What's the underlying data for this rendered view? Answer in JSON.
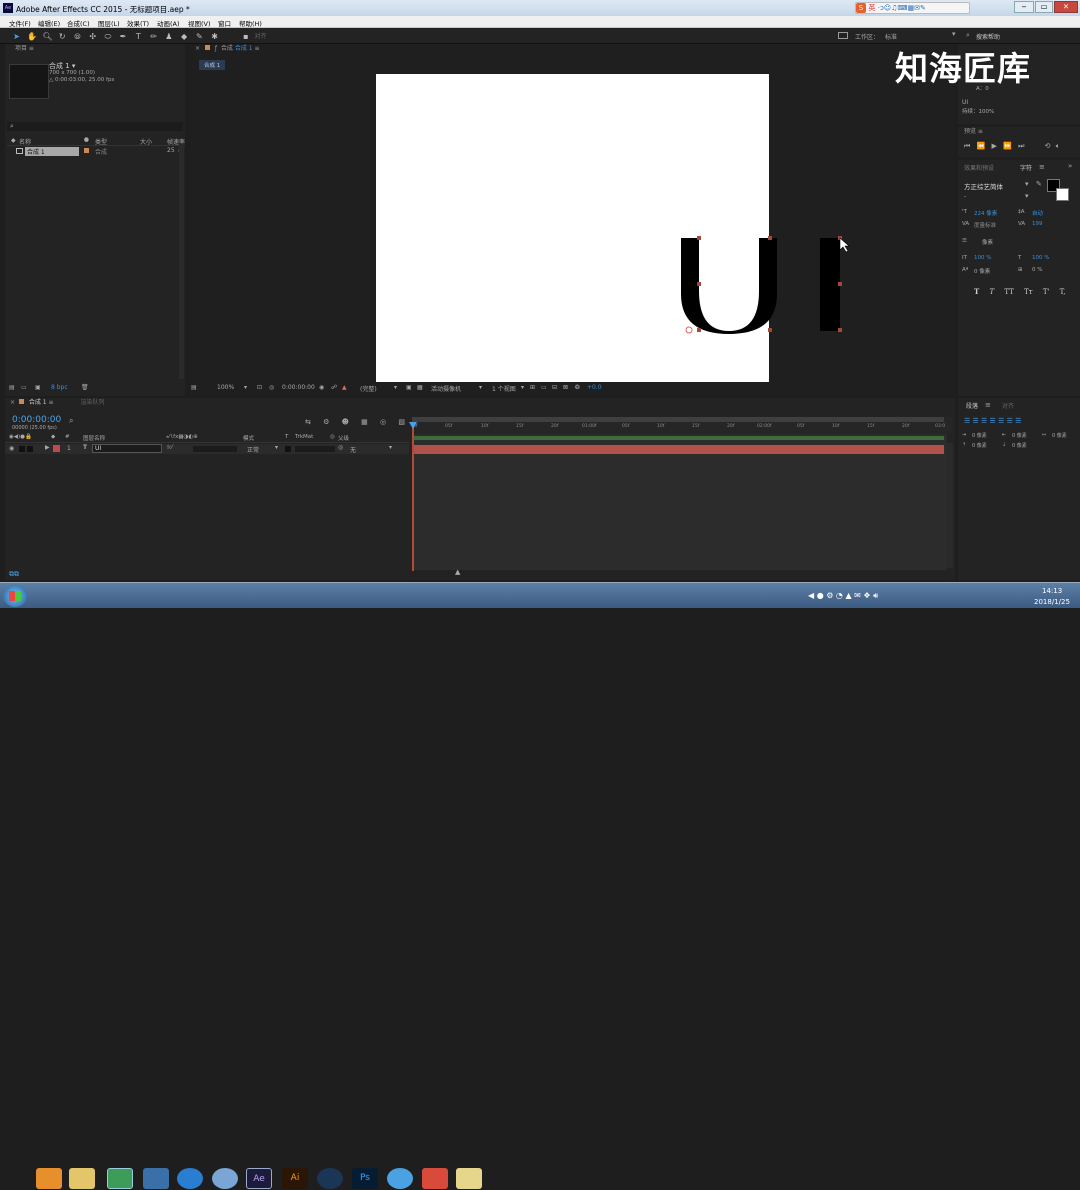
{
  "window": {
    "title": "Adobe After Effects CC 2015 - 无标题项目.aep *",
    "app_badge": "Ae"
  },
  "ime": {
    "label": "英"
  },
  "menu": [
    "文件(F)",
    "编辑(E)",
    "合成(C)",
    "图层(L)",
    "效果(T)",
    "动画(A)",
    "视图(V)",
    "窗口",
    "帮助(H)"
  ],
  "toolbar": {
    "snap_label": "对齐",
    "workspace_label": "工作区：",
    "workspace_value": "标准",
    "search_placeholder": "搜索帮助"
  },
  "watermark": "知海匠库",
  "project": {
    "tab": "项目",
    "comp_name": "合成 1 ▾",
    "comp_size": "700 x 700 (1.00)",
    "comp_duration": "△ 0:00:03:00, 25.00 fps",
    "search_icon": "⌕",
    "col_name": "名称",
    "col_type": "类型",
    "col_size": "大小",
    "col_rate": "帧速率",
    "item_name": "合成 1",
    "item_type": "合成",
    "item_rate": "25",
    "bpc": "8 bpc"
  },
  "composition": {
    "tab_prefix": "合成",
    "tab_name": "合成 1",
    "breadcrumb": "合成 1",
    "text": "UI",
    "zoom": "100%",
    "timecode": "0:00:00:00",
    "resolution": "(完整)",
    "camera": "活动摄像机",
    "views": "1 个视图",
    "exposure": "+0.0"
  },
  "info": {
    "a_label": "A：0",
    "layer_label": "UI",
    "duration_label": "持续：100%"
  },
  "preview": {
    "tab": "预览"
  },
  "character": {
    "tab_effects": "效果和预设",
    "tab_char": "字符",
    "font": "方正综艺简体",
    "style": "-",
    "size": "224 像素",
    "leading": "自动",
    "kerning": "度量标准",
    "tracking": "199",
    "stroke": "像素",
    "vscale": "100 %",
    "hscale": "100 %",
    "baseline": "0 像素",
    "tsume": "0 %",
    "styles": [
      "T",
      "T",
      "TT",
      "Tт",
      "T'",
      "T,"
    ]
  },
  "timeline": {
    "tab": "合成 1",
    "queue_tab": "渲染队列",
    "timecode": "0:00:00:00",
    "frame_info": "00000 (25.00 fps)",
    "col_layer": "图层名称",
    "col_mode": "模式",
    "col_trkmat": "TrkMat",
    "col_parent": "父级",
    "layer_num": "1",
    "layer_name": "UI",
    "layer_mode": "正常",
    "layer_parent": "无",
    "ruler": [
      "0f",
      "05f",
      "10f",
      "15f",
      "20f",
      "01:00f",
      "05f",
      "10f",
      "15f",
      "20f",
      "02:00f",
      "05f",
      "10f",
      "15f",
      "20f",
      "03:0"
    ]
  },
  "paragraph": {
    "tab": "段落",
    "tab2": "对齐",
    "indent1": "0 像素",
    "indent2": "0 像素",
    "indent3": "0 像素",
    "space1": "0 像素",
    "space2": "0 像素"
  },
  "taskbar": {
    "time": "14:13",
    "date": "2018/1/25"
  },
  "colors": {
    "accent_blue": "#2d8cff",
    "timecode_blue": "#4aa3e8",
    "layer_red": "#c04a4a",
    "title_bg": "#d7e4f2"
  }
}
